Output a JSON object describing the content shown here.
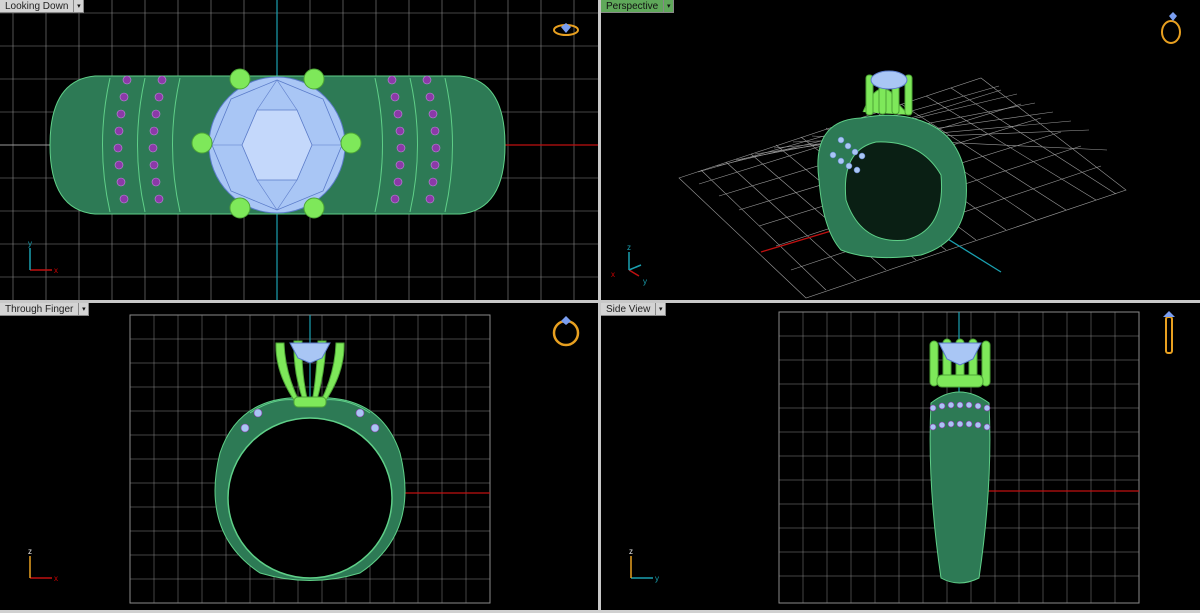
{
  "viewports": [
    {
      "id": "top",
      "title": "Looking Down",
      "active": false
    },
    {
      "id": "perspective",
      "title": "Perspective",
      "active": true
    },
    {
      "id": "front",
      "title": "Through Finger",
      "active": false
    },
    {
      "id": "side",
      "title": "Side View",
      "active": false
    }
  ],
  "axes": {
    "top": [
      "x",
      "y"
    ],
    "perspective": [
      "x",
      "y",
      "z"
    ],
    "front": [
      "x",
      "z"
    ],
    "side": [
      "y",
      "z"
    ]
  },
  "colors": {
    "ring_metal": "#2d7a55",
    "ring_metal_dark": "#1d5a3e",
    "prong": "#7ee85a",
    "gem": "#a9c6f5",
    "small_stone": "#8b3aa8",
    "grid": "#9a9a9a",
    "axis_red": "#c01010",
    "axis_cyan": "#1aa0b0"
  }
}
